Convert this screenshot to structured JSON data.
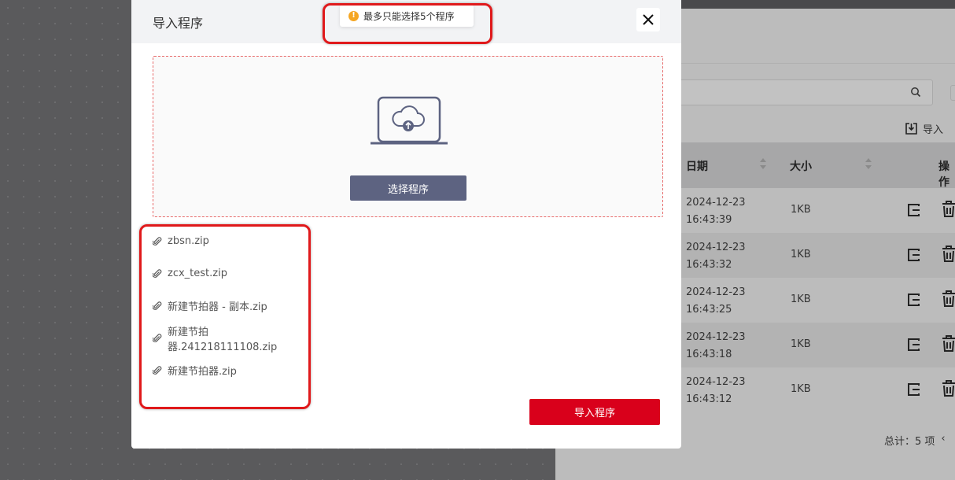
{
  "modal": {
    "title": "导入程序",
    "toast_message": "最多只能选择5个程序",
    "select_button_label": "选择程序",
    "import_button_label": "导入程序",
    "files": [
      {
        "name": "zbsn.zip"
      },
      {
        "name": "zcx_test.zip"
      },
      {
        "name": "新建节拍器 - 副本.zip"
      },
      {
        "name": "新建节拍器.241218111108.zip"
      },
      {
        "name": "新建节拍器.zip"
      }
    ]
  },
  "background": {
    "toolbar": {
      "import_label": "导入"
    },
    "table": {
      "headers": {
        "date": "日期",
        "size": "大小",
        "actions": "操作"
      },
      "rows": [
        {
          "date": "2024-12-23",
          "time": "16:43:39",
          "size": "1KB"
        },
        {
          "date": "2024-12-23",
          "time": "16:43:32",
          "size": "1KB"
        },
        {
          "date": "2024-12-23",
          "time": "16:43:25",
          "size": "1KB"
        },
        {
          "date": "2024-12-23",
          "time": "16:43:18",
          "size": "1KB"
        },
        {
          "date": "2024-12-23",
          "time": "16:43:12",
          "size": "1KB"
        }
      ]
    },
    "pagination": {
      "total_label": "总计：5 项"
    }
  },
  "colors": {
    "primary_red": "#d9001b",
    "select_button": "#5d6381",
    "warning": "#f5a623",
    "annotation": "#e0191b"
  },
  "icons": [
    "close-icon",
    "warning-icon",
    "cloud-upload-icon",
    "paperclip-icon",
    "search-icon",
    "import-icon",
    "edit-icon",
    "trash-icon",
    "sort-icon"
  ]
}
